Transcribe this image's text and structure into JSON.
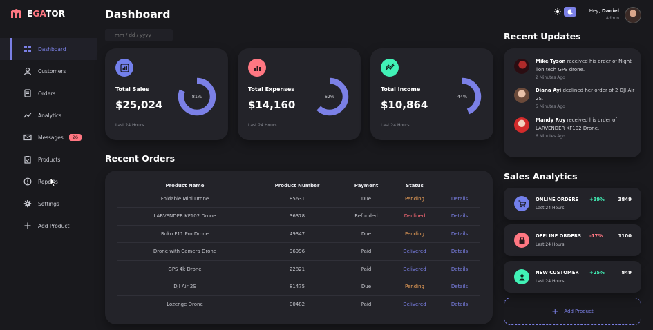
{
  "brand": {
    "prefix": "E",
    "middle": "GA",
    "suffix": "TOR"
  },
  "sidebar": {
    "items": [
      {
        "label": "Dashboard",
        "icon": "grid-icon"
      },
      {
        "label": "Customers",
        "icon": "user-icon"
      },
      {
        "label": "Orders",
        "icon": "receipt-icon"
      },
      {
        "label": "Analytics",
        "icon": "trend-icon"
      },
      {
        "label": "Messages",
        "icon": "mail-icon",
        "badge": "26"
      },
      {
        "label": "Products",
        "icon": "clipboard-icon"
      },
      {
        "label": "Reports",
        "icon": "report-icon"
      },
      {
        "label": "Settings",
        "icon": "gear-icon"
      },
      {
        "label": "Add Product",
        "icon": "plus-icon"
      }
    ]
  },
  "header": {
    "title": "Dashboard",
    "date_placeholder": "mm / dd / yyyy",
    "greeting": "Hey,",
    "user_name": "Daniel",
    "user_role": "Admin"
  },
  "stats": [
    {
      "label": "Total Sales",
      "value": "$25,024",
      "percent_label": "81%",
      "percent": 81,
      "sub": "Last 24 Hours",
      "color": "#7380ec",
      "icon": "bar-chart-icon"
    },
    {
      "label": "Total Expenses",
      "value": "$14,160",
      "percent_label": "62%",
      "percent": 62,
      "sub": "Last 24 Hours",
      "color": "#ff7782",
      "icon": "bar-chart-icon"
    },
    {
      "label": "Total Income",
      "value": "$10,864",
      "percent_label": "44%",
      "percent": 44,
      "sub": "Last 24 Hours",
      "color": "#41f1b6",
      "icon": "trend-icon"
    }
  ],
  "ring_color": "#7b80e6",
  "orders": {
    "title": "Recent Orders",
    "headers": [
      "Product Name",
      "Product Number",
      "Payment",
      "Status",
      ""
    ],
    "rows": [
      {
        "name": "Foldable Mini Drone",
        "number": "85631",
        "payment": "Due",
        "status": "Pending",
        "link": "Details"
      },
      {
        "name": "LARVENDER KF102 Drone",
        "number": "36378",
        "payment": "Refunded",
        "status": "Declined",
        "link": "Details"
      },
      {
        "name": "Ruko F11 Pro Drone",
        "number": "49347",
        "payment": "Due",
        "status": "Pending",
        "link": "Details"
      },
      {
        "name": "Drone with Camera Drone",
        "number": "96996",
        "payment": "Paid",
        "status": "Delivered",
        "link": "Details"
      },
      {
        "name": "GPS 4k Drone",
        "number": "22821",
        "payment": "Paid",
        "status": "Delivered",
        "link": "Details"
      },
      {
        "name": "DJI Air 2S",
        "number": "81475",
        "payment": "Due",
        "status": "Pending",
        "link": "Details"
      },
      {
        "name": "Lozenge Drone",
        "number": "00482",
        "payment": "Paid",
        "status": "Delivered",
        "link": "Details"
      }
    ]
  },
  "updates": {
    "title": "Recent Updates",
    "items": [
      {
        "name": "Mike Tyson",
        "text": " received his order of Night lion tech GPS drone.",
        "time": "2 Minutes Ago"
      },
      {
        "name": "Diana Ayi",
        "text": " declined her order of 2 DJI Air 2S.",
        "time": "5 Minutes Ago"
      },
      {
        "name": "Mandy Roy",
        "text": " received his order of LARVENDER KF102 Drone.",
        "time": "6 Minutes Ago"
      }
    ]
  },
  "analytics": {
    "title": "Sales Analytics",
    "items": [
      {
        "title": "ONLINE ORDERS",
        "sub": "Last 24 Hours",
        "change": "+39%",
        "count": "3849",
        "change_color": "#41f1b6",
        "icon_color": "#7380ec",
        "icon": "cart-icon"
      },
      {
        "title": "OFFLINE ORDERS",
        "sub": "Last 24 Hours",
        "change": "-17%",
        "count": "1100",
        "change_color": "#ff7782",
        "icon_color": "#ff7782",
        "icon": "bag-icon"
      },
      {
        "title": "NEW CUSTOMER",
        "sub": "Last 24 Hours",
        "change": "+25%",
        "count": "849",
        "change_color": "#41f1b6",
        "icon_color": "#41f1b6",
        "icon": "person-icon"
      }
    ],
    "add_label": "Add Product"
  }
}
